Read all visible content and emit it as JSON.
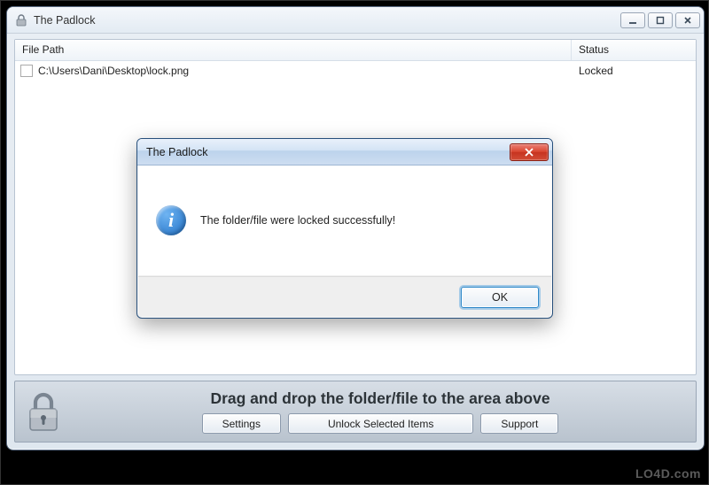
{
  "app": {
    "title": "The Padlock",
    "columns": {
      "path": "File Path",
      "status": "Status"
    },
    "rows": [
      {
        "path": "C:\\Users\\Dani\\Desktop\\lock.png",
        "status": "Locked"
      }
    ],
    "drag_hint": "Drag and drop the folder/file to the area above",
    "buttons": {
      "settings": "Settings",
      "unlock": "Unlock Selected Items",
      "support": "Support"
    }
  },
  "dialog": {
    "title": "The Padlock",
    "message": "The folder/file were locked successfully!",
    "ok": "OK"
  },
  "watermark": "LO4D.com"
}
